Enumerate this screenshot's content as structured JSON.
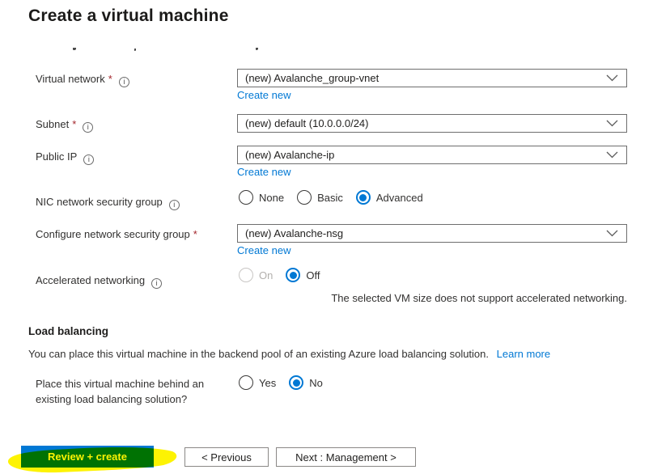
{
  "page": {
    "title": "Create a virtual machine"
  },
  "icons": {
    "info": "i",
    "chevron_down": "v"
  },
  "form": {
    "virtual_network": {
      "label": "Virtual network",
      "required": "*",
      "value": "(new) Avalanche_group-vnet",
      "create_new": "Create new"
    },
    "subnet": {
      "label": "Subnet",
      "required": "*",
      "value": "(new) default (10.0.0.0/24)"
    },
    "public_ip": {
      "label": "Public IP",
      "value": "(new) Avalanche-ip",
      "create_new": "Create new"
    },
    "nic_nsg": {
      "label": "NIC network security group",
      "options": {
        "none": "None",
        "basic": "Basic",
        "advanced": "Advanced"
      },
      "selected": "Advanced"
    },
    "configure_nsg": {
      "label": "Configure network security group",
      "required": "*",
      "value": "(new) Avalanche-nsg",
      "create_new": "Create new"
    },
    "accelerated_networking": {
      "label": "Accelerated networking",
      "options": {
        "on": "On",
        "off": "Off"
      },
      "selected": "Off",
      "disabled_option": "On",
      "note": "The selected VM size does not support accelerated networking."
    }
  },
  "load_balancing": {
    "heading": "Load balancing",
    "description": "You can place this virtual machine in the backend pool of an existing Azure load balancing solution.",
    "learn_more": "Learn more",
    "question": {
      "label": "Place this virtual machine behind an existing load balancing solution?",
      "options": {
        "yes": "Yes",
        "no": "No"
      },
      "selected": "No"
    }
  },
  "footer": {
    "review_create": "Review + create",
    "previous": "< Previous",
    "next": "Next : Management >"
  },
  "colors": {
    "accent_blue": "#0078d4",
    "link_blue": "#0078d4",
    "required_red": "#a4262c",
    "highlight_yellow": "#fdf303",
    "highlighted_button_green": "#007500",
    "border_gray": "#6e6e6e"
  }
}
